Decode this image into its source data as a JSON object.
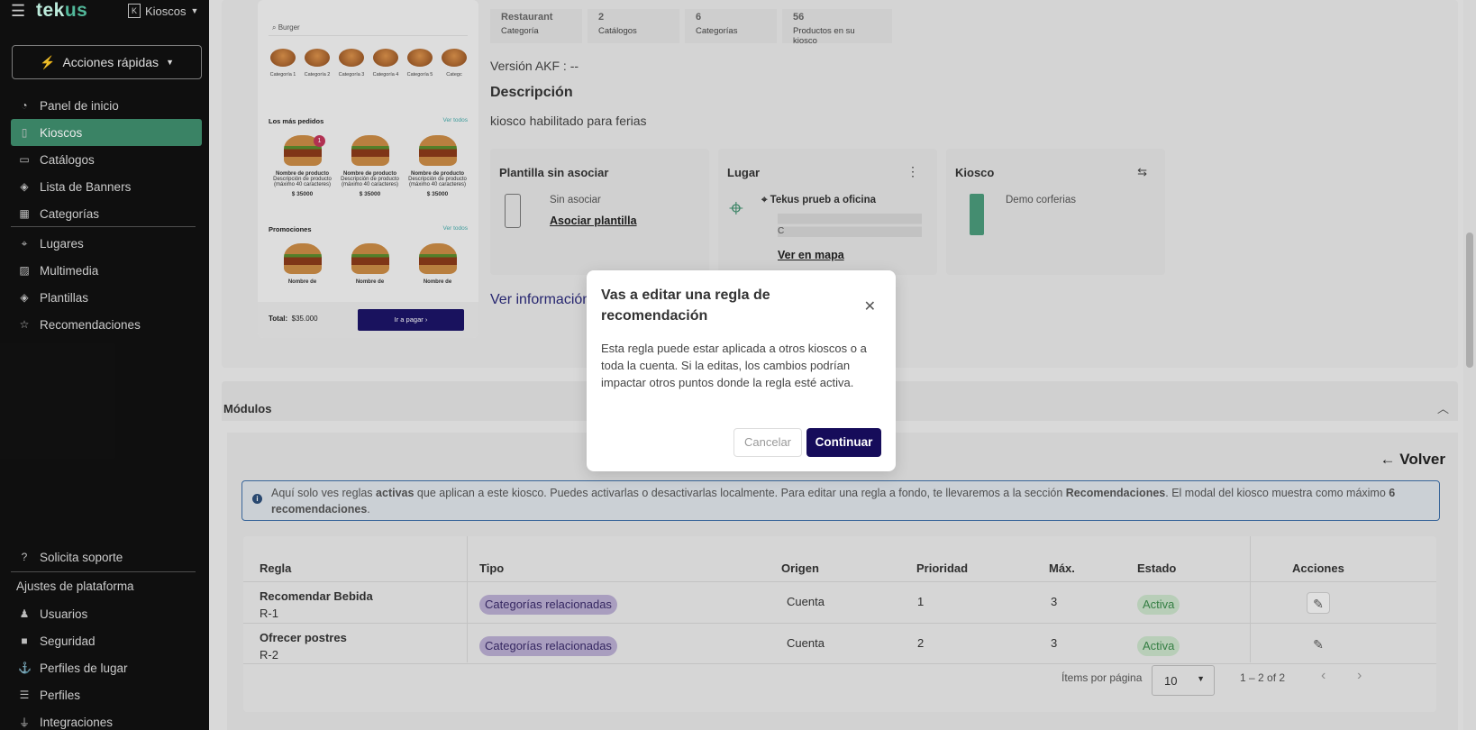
{
  "sidebar": {
    "brand_main": "tek",
    "brand_accent": "us",
    "kiosk_selector": "Kioscos",
    "quick_actions": "Acciones rápidas",
    "items": [
      {
        "label": "Panel de inicio",
        "icon": "dashboard-icon"
      },
      {
        "label": "Kioscos",
        "icon": "kiosk-icon",
        "active": true
      },
      {
        "label": "Catálogos",
        "icon": "book-icon"
      },
      {
        "label": "Lista de Banners",
        "icon": "layers-icon"
      },
      {
        "label": "Categorías",
        "icon": "category-icon"
      },
      {
        "label": "Lugares",
        "icon": "location-icon"
      },
      {
        "label": "Multimedia",
        "icon": "image-icon"
      },
      {
        "label": "Plantillas",
        "icon": "layers-icon"
      },
      {
        "label": "Recomendaciones",
        "icon": "star-icon"
      }
    ],
    "support": "Solicita soporte",
    "settings_label": "Ajustes de plataforma",
    "settings_items": [
      {
        "label": "Usuarios",
        "icon": "users-icon"
      },
      {
        "label": "Seguridad",
        "icon": "lock-icon"
      },
      {
        "label": "Perfiles de lugar",
        "icon": "place-profile-icon"
      },
      {
        "label": "Perfiles",
        "icon": "profiles-icon"
      },
      {
        "label": "Integraciones",
        "icon": "plug-icon"
      }
    ]
  },
  "preview": {
    "search": "Burger",
    "categories": [
      "Categoría 1",
      "Categoría 2",
      "Categoría 3",
      "Categoría 4",
      "Categoría 5",
      "Categc"
    ],
    "most_ordered": "Los más pedidos",
    "see_all": "Ver todos",
    "product_name": "Nombre de producto",
    "product_desc": "Descripción de producto (máximo 40 caracteres)",
    "price": "$ 35000",
    "badge": "1",
    "promotions": "Promociones",
    "promo_name": "Nombre de",
    "total_label": "Total:",
    "total_value": "$35.000",
    "pay_button": "Ir a pagar"
  },
  "stats": [
    {
      "value": "Restaurant",
      "label": "Categoría"
    },
    {
      "value": "2",
      "label": "Catálogos"
    },
    {
      "value": "6",
      "label": "Categorías"
    },
    {
      "value": "56",
      "label": "Productos en su kiosco"
    }
  ],
  "version": "Versión AKF : --",
  "description_title": "Descripción",
  "description": "kiosco habilitado para ferias",
  "template_box": {
    "title": "Plantilla sin asociar",
    "status": "Sin asociar",
    "link": "Asociar plantilla"
  },
  "place_box": {
    "title": "Lugar",
    "name": "Tekus prueb a oficina",
    "address_prefix": "C",
    "link": "Ver en mapa"
  },
  "kiosk_box": {
    "title": "Kiosco",
    "name": "Demo corferias"
  },
  "more_info": "Ver información",
  "modules": {
    "title": "Módulos",
    "back": "Volver",
    "info_parts": [
      "Aquí solo ves reglas ",
      "activas",
      " que aplican a este kiosco. Puedes activarlas o desactivarlas localmente. Para editar una regla a fondo, te llevaremos a la sección ",
      "Recomendaciones",
      ". El modal del kiosco muestra como máximo ",
      "6 recomendaciones",
      "."
    ],
    "columns": [
      "Regla",
      "Tipo",
      "Origen",
      "Prioridad",
      "Máx.",
      "Estado",
      "Acciones"
    ],
    "rows": [
      {
        "name": "Recomendar Bebida",
        "id": "R-1",
        "type": "Categorías relacionadas",
        "origin": "Cuenta",
        "priority": "1",
        "max": "3",
        "status": "Activa"
      },
      {
        "name": "Ofrecer postres",
        "id": "R-2",
        "type": "Categorías relacionadas",
        "origin": "Cuenta",
        "priority": "2",
        "max": "3",
        "status": "Activa"
      }
    ],
    "items_per_page_label": "Ítems por página",
    "items_per_page": "10",
    "range": "1 – 2 of 2"
  },
  "modal": {
    "title": "Vas a editar una regla de recomendación",
    "body": "Esta regla puede estar aplicada a otros kioscos o a toda la cuenta. Si la editas, los cambios podrían impactar otros puntos donde la regla esté activa.",
    "cancel": "Cancelar",
    "confirm": "Continuar"
  },
  "colors": {
    "accent": "#3f8f6e",
    "primary": "#160c5a",
    "chip": "#b8acd0",
    "active": "#3a8a4a"
  }
}
